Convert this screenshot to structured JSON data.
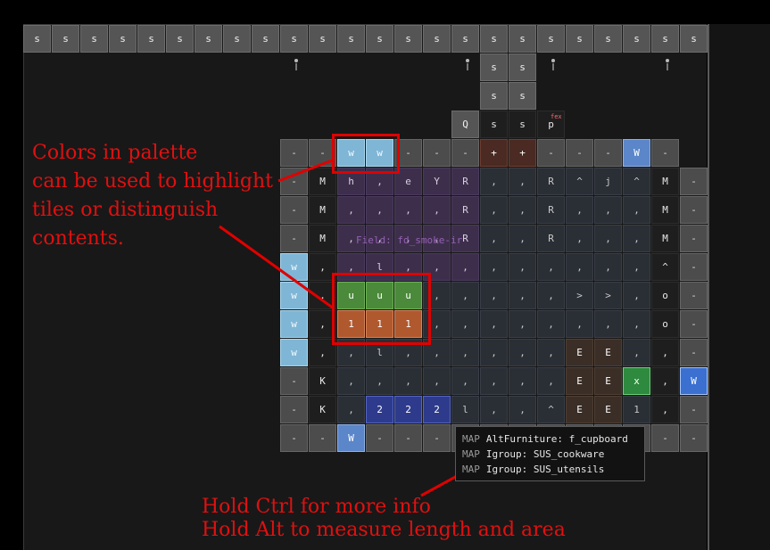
{
  "map": {
    "top_row_glyph": "s",
    "field_label": "Field: fd_smoke-ir",
    "rows": [
      [
        "-",
        "-",
        "w",
        "w",
        "-",
        "-",
        "-",
        "+",
        "+",
        "-",
        "-",
        "-",
        "W",
        "-"
      ],
      [
        "-",
        "M",
        "h",
        ",",
        "e",
        "Y",
        "R",
        ",",
        ",",
        "R",
        "^",
        "j",
        "^",
        "M",
        "-"
      ],
      [
        "-",
        "M",
        ",",
        ",",
        ",",
        ",",
        "R",
        ",",
        ",",
        "R",
        ",",
        ",",
        ",",
        "M",
        "-"
      ],
      [
        "-",
        "M",
        ",",
        ",",
        ",",
        ",",
        "R",
        ",",
        ",",
        "R",
        ",",
        ",",
        ",",
        "M",
        "-"
      ],
      [
        "w",
        ",",
        ",",
        "l",
        ",",
        ",",
        ",",
        ",",
        ",",
        ",",
        ",",
        ",",
        ",",
        "^",
        "-"
      ],
      [
        "w",
        ".",
        "u",
        "u",
        "u",
        ",",
        ",",
        ",",
        ",",
        ",",
        ">",
        ">",
        ",",
        "o",
        "-"
      ],
      [
        "w",
        ",",
        "1",
        "1",
        "1",
        ",",
        ",",
        ",",
        ",",
        ",",
        ",",
        ",",
        ",",
        "o",
        "-"
      ],
      [
        "w",
        ",",
        ",",
        "l",
        ",",
        ",",
        ",",
        ",",
        ",",
        ",",
        "E",
        "E",
        ",",
        ",",
        "-"
      ],
      [
        "-",
        "K",
        ",",
        ",",
        ",",
        ",",
        ",",
        ",",
        ",",
        ",",
        "E",
        "E",
        "x",
        ",",
        "W"
      ],
      [
        "-",
        "K",
        ",",
        "2",
        "2",
        "2",
        "l",
        ",",
        ",",
        "^",
        "E",
        "E",
        "1",
        ",",
        "-"
      ],
      [
        "-",
        "-",
        "W",
        "-",
        "-",
        "-",
        "-",
        "-",
        "-",
        "-",
        "-",
        "-",
        "-",
        "-",
        "-"
      ]
    ],
    "upper_column": [
      "s",
      "s",
      "s",
      "s",
      "Q",
      "s",
      "s",
      "p"
    ],
    "tiny_tag": "fex"
  },
  "callouts": {
    "palette": "Colors in palette\ncan be used to highlight\ntiles or distinguish\ncontents.",
    "ctrl": "Hold Ctrl for more info",
    "alt": "Hold Alt to measure length and area"
  },
  "tooltip": {
    "rows": [
      {
        "tag": "MAP",
        "text": "AltFurniture: f_cupboard"
      },
      {
        "tag": "MAP",
        "text": "Igroup: SUS_cookware"
      },
      {
        "tag": "MAP",
        "text": "Igroup: SUS_utensils"
      }
    ]
  }
}
